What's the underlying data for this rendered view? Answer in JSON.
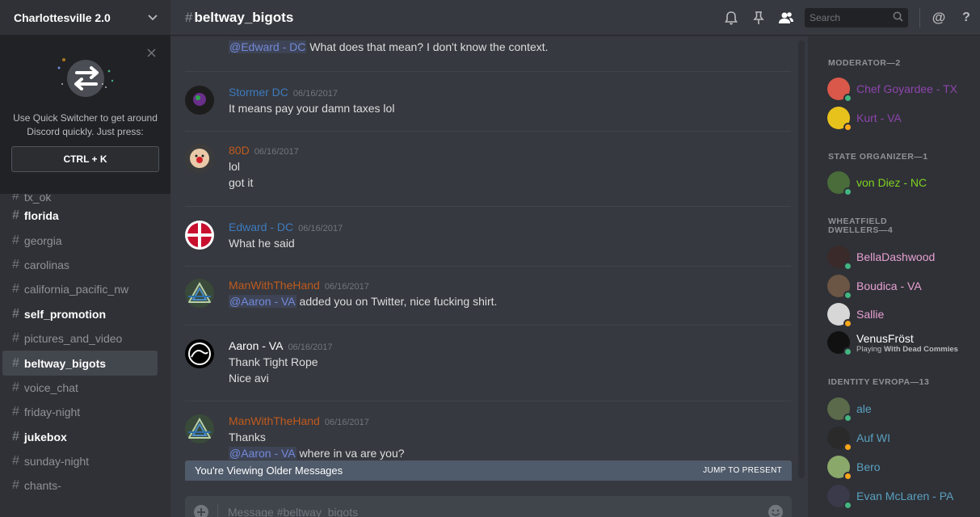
{
  "server": {
    "name": "Charlottesville 2.0"
  },
  "switcher": {
    "text_line1": "Use Quick Switcher to get around",
    "text_line2": "Discord quickly. Just press:",
    "shortcut": "CTRL + K"
  },
  "channels": [
    {
      "name": "tx_ok",
      "state": "muted",
      "partial": true
    },
    {
      "name": "florida",
      "state": "unread"
    },
    {
      "name": "georgia",
      "state": "muted"
    },
    {
      "name": "carolinas",
      "state": "muted"
    },
    {
      "name": "california_pacific_nw",
      "state": "muted"
    },
    {
      "name": "self_promotion",
      "state": "unread"
    },
    {
      "name": "pictures_and_video",
      "state": "muted"
    },
    {
      "name": "beltway_bigots",
      "state": "active"
    },
    {
      "name": "voice_chat",
      "state": "muted"
    },
    {
      "name": "friday-night",
      "state": "muted"
    },
    {
      "name": "jukebox",
      "state": "unread"
    },
    {
      "name": "sunday-night",
      "state": "muted"
    },
    {
      "name": "chants-",
      "state": "muted"
    }
  ],
  "header": {
    "channel": "beltway_bigots",
    "search_placeholder": "Search",
    "mention_icon": "@",
    "help_icon": "?"
  },
  "messages": [
    {
      "author": "",
      "date": "",
      "lines": [
        {
          "mention": "@Edward - DC",
          "text": " What does that mean? I don't know the context."
        }
      ]
    },
    {
      "author": "Stormer DC",
      "color": "#3e7bbf",
      "date": "06/16/2017",
      "lines": [
        {
          "text": "It means pay your damn taxes lol"
        }
      ]
    },
    {
      "author": "80D",
      "color": "#c05a1e",
      "date": "06/16/2017",
      "lines": [
        {
          "text": "lol"
        },
        {
          "text": "got it"
        }
      ]
    },
    {
      "author": "Edward - DC",
      "color": "#3e7bbf",
      "date": "06/16/2017",
      "lines": [
        {
          "text": "What he said"
        }
      ]
    },
    {
      "author": "ManWithTheHand",
      "color": "#c05a1e",
      "date": "06/16/2017",
      "lines": [
        {
          "mention": "@Aaron - VA",
          "text": " added you on Twitter, nice fucking shirt."
        }
      ]
    },
    {
      "author": "Aaron - VA",
      "color": "#ffffff",
      "date": "06/16/2017",
      "lines": [
        {
          "text": "Thank Tight Rope"
        },
        {
          "text": "Nice avi"
        }
      ]
    },
    {
      "author": "ManWithTheHand",
      "color": "#c05a1e",
      "date": "06/16/2017",
      "lines": [
        {
          "text": "Thanks"
        },
        {
          "mention": "@Aaron - VA",
          "text": " where in va are you?"
        }
      ]
    }
  ],
  "older_bar": {
    "text": "You're Viewing Older Messages",
    "jump": "JUMP TO PRESENT"
  },
  "composer": {
    "placeholder": "Message #beltway_bigots"
  },
  "member_groups": [
    {
      "title": "MODERATOR—2",
      "members": [
        {
          "name": "Chef Goyardee - TX",
          "color": "#8e44ad",
          "status": "#43b581"
        },
        {
          "name": "Kurt - VA",
          "color": "#8e44ad",
          "status": "#faa61a"
        }
      ]
    },
    {
      "title": "STATE ORGANIZER—1",
      "members": [
        {
          "name": "von Diez - NC",
          "color": "#7ed321",
          "status": "#43b581"
        }
      ]
    },
    {
      "title": "WHEATFIELD DWELLERS—4",
      "members": [
        {
          "name": "BellaDashwood",
          "color": "#e8a0d4",
          "status": "#43b581"
        },
        {
          "name": "Boudica - VA",
          "color": "#e8a0d4",
          "status": "#43b581"
        },
        {
          "name": "Sallie",
          "color": "#e8a0d4",
          "status": "#faa61a"
        },
        {
          "name": "VenusFröst",
          "color": "#ffffff",
          "status": "#43b581",
          "game_prefix": "Playing",
          "game": "With Dead Commies"
        }
      ]
    },
    {
      "title": "IDENTITY EVROPA—13",
      "members": [
        {
          "name": "ale",
          "color": "#5aa0c0",
          "status": "#43b581"
        },
        {
          "name": "Auf WI",
          "color": "#5aa0c0",
          "status": "#faa61a"
        },
        {
          "name": "Bero",
          "color": "#5aa0c0",
          "status": "#faa61a"
        },
        {
          "name": "Evan McLaren - PA",
          "color": "#5aa0c0",
          "status": "#43b581"
        }
      ]
    }
  ]
}
